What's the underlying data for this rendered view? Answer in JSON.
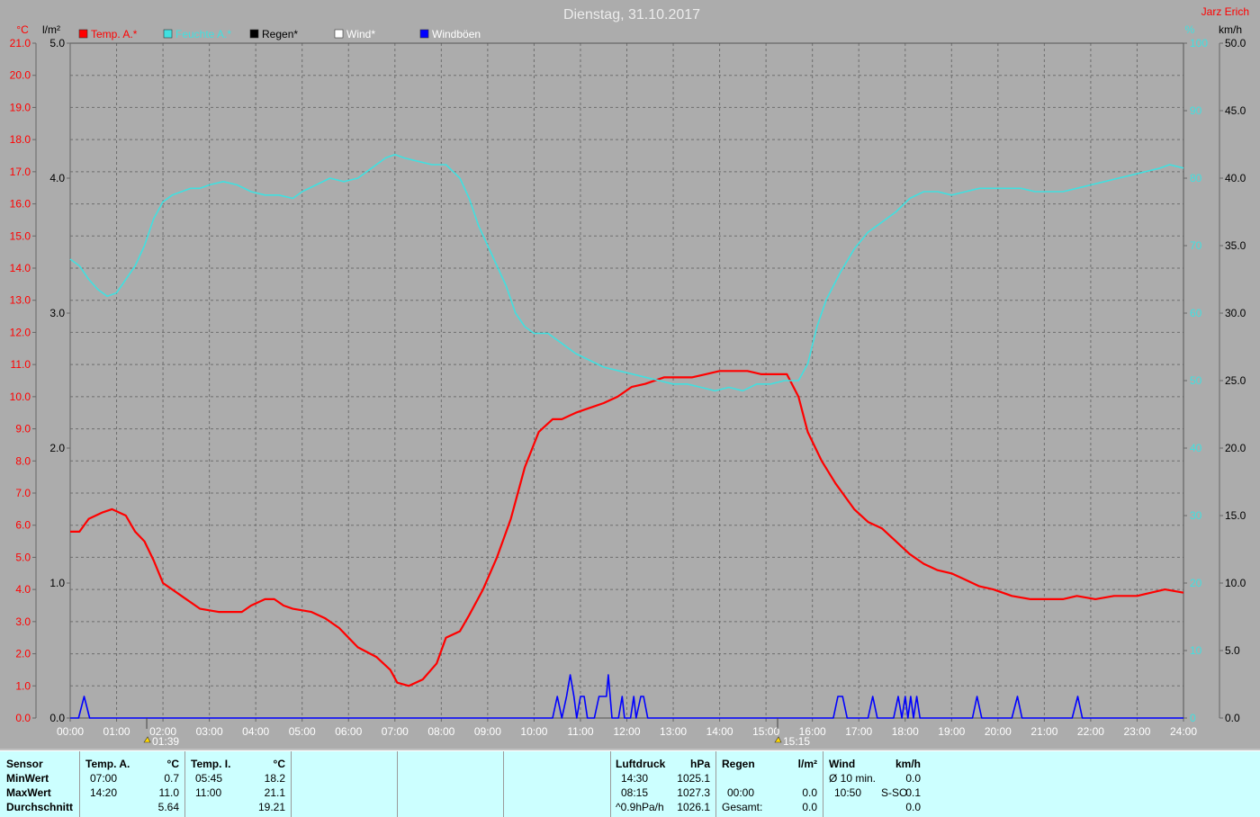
{
  "chart_data": {
    "type": "line",
    "title": "Dienstag, 31.10.2017",
    "author": "Jarz Erich",
    "left_axes": {
      "temp": {
        "unit": "°C",
        "min": 0,
        "max": 21,
        "step": 1,
        "color": "#ff0000"
      },
      "rain": {
        "unit": "l/m²",
        "min": 0,
        "max": 5,
        "step": 1,
        "color": "#000000"
      }
    },
    "right_axes": {
      "humidity": {
        "unit": "%",
        "min": 0,
        "max": 100,
        "step": 10,
        "color": "#40e0e0"
      },
      "wind": {
        "unit": "km/h",
        "min": 0,
        "max": 50,
        "step": 5,
        "color": "#000000"
      }
    },
    "x_ticks": [
      "00:00",
      "01:00",
      "02:00",
      "03:00",
      "04:00",
      "05:00",
      "06:00",
      "07:00",
      "08:00",
      "09:00",
      "10:00",
      "11:00",
      "12:00",
      "13:00",
      "14:00",
      "15:00",
      "16:00",
      "17:00",
      "18:00",
      "19:00",
      "20:00",
      "21:00",
      "22:00",
      "23:00",
      "24:00"
    ],
    "legend": [
      {
        "name": "Temp. A.*",
        "color": "#ff0000",
        "text_color": "#ff0000"
      },
      {
        "name": "Feuchte A.*",
        "color": "#40e0e0",
        "text_color": "#40e0e0"
      },
      {
        "name": "Regen*",
        "color": "#000000",
        "text_color": "#000000"
      },
      {
        "name": "Wind*",
        "color": "#ffffff",
        "text_color": "#ffffff"
      },
      {
        "name": "Windböen",
        "color": "#0000ff",
        "text_color": "#ffffff"
      }
    ],
    "markers": [
      {
        "time": 1.65,
        "label": "01:39"
      },
      {
        "time": 15.25,
        "label": "15:15"
      }
    ],
    "series": [
      {
        "name": "Temp. A.*",
        "axis": "temp",
        "color": "#ff0000",
        "x": [
          0,
          0.2,
          0.4,
          0.7,
          0.9,
          1.2,
          1.4,
          1.6,
          1.8,
          2.0,
          2.4,
          2.8,
          3.2,
          3.7,
          3.9,
          4.2,
          4.4,
          4.6,
          4.8,
          5.2,
          5.5,
          5.8,
          6.2,
          6.6,
          6.9,
          7.05,
          7.3,
          7.6,
          7.9,
          8.1,
          8.4,
          8.6,
          8.9,
          9.2,
          9.5,
          9.8,
          10.1,
          10.4,
          10.6,
          10.9,
          11.1,
          11.3,
          11.5,
          11.8,
          12.1,
          12.4,
          12.8,
          13.1,
          13.4,
          13.7,
          14.0,
          14.3,
          14.6,
          14.9,
          15.2,
          15.45,
          15.7,
          15.9,
          16.2,
          16.5,
          16.9,
          17.2,
          17.5,
          17.8,
          18.1,
          18.4,
          18.7,
          19.0,
          19.3,
          19.6,
          19.9,
          20.3,
          20.7,
          21.0,
          21.4,
          21.7,
          22.1,
          22.5,
          23.0,
          23.3,
          23.6,
          24.0
        ],
        "y": [
          5.8,
          5.8,
          6.2,
          6.4,
          6.5,
          6.3,
          5.8,
          5.5,
          4.9,
          4.2,
          3.8,
          3.4,
          3.3,
          3.3,
          3.5,
          3.7,
          3.7,
          3.5,
          3.4,
          3.3,
          3.1,
          2.8,
          2.2,
          1.9,
          1.5,
          1.1,
          1.0,
          1.2,
          1.7,
          2.5,
          2.7,
          3.2,
          4.0,
          5.0,
          6.2,
          7.8,
          8.9,
          9.3,
          9.3,
          9.5,
          9.6,
          9.7,
          9.8,
          10.0,
          10.3,
          10.4,
          10.6,
          10.6,
          10.6,
          10.7,
          10.8,
          10.8,
          10.8,
          10.7,
          10.7,
          10.7,
          10.0,
          8.9,
          8.0,
          7.3,
          6.5,
          6.1,
          5.9,
          5.5,
          5.1,
          4.8,
          4.6,
          4.5,
          4.3,
          4.1,
          4.0,
          3.8,
          3.7,
          3.7,
          3.7,
          3.8,
          3.7,
          3.8,
          3.8,
          3.9,
          4.0,
          3.9
        ]
      },
      {
        "name": "Feuchte A.*",
        "axis": "humidity",
        "color": "#40e0e0",
        "x": [
          0,
          0.2,
          0.4,
          0.6,
          0.8,
          1.0,
          1.2,
          1.4,
          1.6,
          1.8,
          2.0,
          2.2,
          2.4,
          2.6,
          2.8,
          3.0,
          3.3,
          3.6,
          3.9,
          4.2,
          4.5,
          4.8,
          5.0,
          5.3,
          5.6,
          5.9,
          6.2,
          6.5,
          6.8,
          7.0,
          7.2,
          7.5,
          7.8,
          8.1,
          8.4,
          8.6,
          8.8,
          9.0,
          9.2,
          9.4,
          9.6,
          9.8,
          10.0,
          10.3,
          10.6,
          10.9,
          11.2,
          11.5,
          11.8,
          12.1,
          12.4,
          12.7,
          13.0,
          13.3,
          13.6,
          13.9,
          14.2,
          14.5,
          14.8,
          15.1,
          15.4,
          15.7,
          15.9,
          16.1,
          16.3,
          16.6,
          16.9,
          17.2,
          17.5,
          17.8,
          18.1,
          18.4,
          18.7,
          19.0,
          19.3,
          19.6,
          19.9,
          20.2,
          20.5,
          20.8,
          21.1,
          21.4,
          21.7,
          22.0,
          22.3,
          22.6,
          22.9,
          23.2,
          23.5,
          23.7,
          24.0
        ],
        "y": [
          68,
          67,
          65,
          63.5,
          62.5,
          63,
          65,
          67,
          70,
          74,
          76.5,
          77.5,
          78,
          78.5,
          78.5,
          79,
          79.5,
          79,
          78,
          77.5,
          77.5,
          77,
          78,
          79,
          80,
          79.5,
          80,
          81.5,
          83,
          83.5,
          83,
          82.5,
          82,
          82,
          80,
          77,
          73,
          70,
          67,
          64,
          60,
          58,
          57,
          57,
          55.5,
          54,
          53,
          52,
          51.5,
          51,
          50.5,
          50,
          49.5,
          49.5,
          49,
          48.5,
          49,
          48.5,
          49.5,
          49.5,
          50,
          50,
          52.5,
          58,
          62,
          66,
          69.5,
          72,
          73.5,
          75,
          77,
          78,
          78,
          77.5,
          78,
          78.5,
          78.5,
          78.5,
          78.5,
          78,
          78,
          78,
          78.5,
          79,
          79.5,
          80,
          80.5,
          81,
          81.5,
          82,
          81.5
        ]
      },
      {
        "name": "Windböen",
        "axis": "wind",
        "color": "#0000ff",
        "x": [
          0,
          0.18,
          0.3,
          0.42,
          0.6,
          10.4,
          10.5,
          10.6,
          10.7,
          10.78,
          10.86,
          10.92,
          11.0,
          11.08,
          11.15,
          11.2,
          11.3,
          11.4,
          11.48,
          11.56,
          11.6,
          11.68,
          11.75,
          11.82,
          11.9,
          11.95,
          12.02,
          12.08,
          12.15,
          12.2,
          12.3,
          12.36,
          12.45,
          12.52,
          12.6,
          16.45,
          16.55,
          16.65,
          16.75,
          16.85,
          17.2,
          17.3,
          17.4,
          17.75,
          17.85,
          17.93,
          18.0,
          18.06,
          18.12,
          18.18,
          18.25,
          18.32,
          19.45,
          19.55,
          19.65,
          20.3,
          20.42,
          20.52,
          21.6,
          21.72,
          21.82,
          24.0
        ],
        "y": [
          0,
          0,
          1.6,
          0,
          0,
          0,
          1.6,
          0,
          1.6,
          3.2,
          1.6,
          0,
          1.6,
          1.6,
          0,
          0,
          0,
          1.6,
          1.6,
          1.6,
          3.2,
          0,
          0,
          0,
          1.6,
          0,
          0,
          0,
          1.6,
          0,
          1.6,
          1.6,
          0,
          0,
          0,
          0,
          1.6,
          1.6,
          0,
          0,
          0,
          1.6,
          0,
          0,
          1.6,
          0,
          1.6,
          0,
          1.6,
          0,
          1.6,
          0,
          0,
          1.6,
          0,
          0,
          1.6,
          0,
          0,
          1.6,
          0,
          0
        ]
      }
    ]
  },
  "summary": {
    "sensor_header": "Sensor",
    "row_labels": [
      "MinWert",
      "MaxWert",
      "Durchschnitt"
    ],
    "temp_a": {
      "title": "Temp. A.",
      "unit": "°C",
      "min_time": "07:00",
      "min": "0.7",
      "max_time": "14:20",
      "max": "11.0",
      "avg": "5.64"
    },
    "temp_i": {
      "title": "Temp. I.",
      "unit": "°C",
      "min_time": "05:45",
      "min": "18.2",
      "max_time": "11:00",
      "max": "21.1",
      "avg": "19.21"
    },
    "pressure": {
      "title": "Luftdruck",
      "unit": "hPa",
      "min_time": "14:30",
      "min": "1025.1",
      "max_time": "08:15",
      "max": "1027.3",
      "trend": "^0.9hPa/h",
      "trend_value": "1026.1"
    },
    "rain": {
      "title": "Regen",
      "unit": "l/m²",
      "time": "00:00",
      "value": "0.0",
      "total_label": "Gesamt:",
      "total": "0.0"
    },
    "wind": {
      "title": "Wind",
      "unit": "km/h",
      "avg_label": "Ø 10 min.",
      "avg": "0.0",
      "time": "10:50",
      "dir": "S-SO",
      "max": "0.1",
      "third": "0.0"
    }
  }
}
